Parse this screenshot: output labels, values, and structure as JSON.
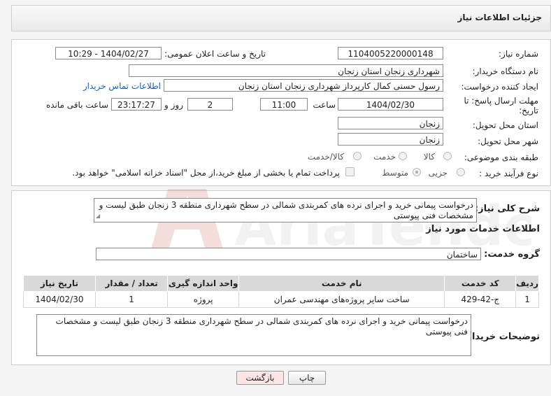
{
  "header": {
    "title": "جزئیات اطلاعات نیاز"
  },
  "form": {
    "need_number_label": "شماره نیاز:",
    "need_number": "1104005220000148",
    "announce_label": "تاریخ و ساعت اعلان عمومی:",
    "announce_value": "1404/02/27 - 10:29",
    "buyer_org_label": "نام دستگاه خریدار:",
    "buyer_org": "شهرداری زنجان استان زنجان",
    "creator_label": "ایجاد کننده درخواست:",
    "creator": "رسول حسنی کمال کارپرداز شهرداری زنجان استان زنجان",
    "contact_link": "اطلاعات تماس خریدار",
    "deadline_label_1": "مهلت ارسال پاسخ: تا",
    "deadline_label_2": "تاریخ:",
    "deadline_date": "1404/02/30",
    "time_label": "ساعت",
    "deadline_time": "11:00",
    "days_value": "2",
    "days_label": "روز و",
    "remaining_time": "23:17:27",
    "remaining_label": "ساعت باقی مانده",
    "province_label": "استان محل تحویل:",
    "province": "زنجان",
    "city_label": "شهر محل تحویل:",
    "city": "زنجان",
    "category_label": "طبقه بندی موضوعی:",
    "category_options": [
      "کالا",
      "خدمت",
      "کالا/خدمت"
    ],
    "process_label": "نوع فرآیند خرید :",
    "process_options": [
      "جزیی",
      "متوسط"
    ],
    "payment_note": "پرداخت تمام یا بخشی از مبلغ خرید،از محل \"اسناد خزانه اسلامی\" خواهد بود."
  },
  "summary": {
    "label": "شرح کلی نیاز:",
    "text": "درخواست پیمانی خرید و اجرای نرده های کمربندی شمالی در سطح شهرداری منطقه 3 زنجان طبق لیست و مشخصات فنی پیوستی"
  },
  "services": {
    "section_title": "اطلاعات خدمات مورد نیاز",
    "group_label": "گروه خدمت:",
    "group_value": "ساختمان",
    "columns": [
      "ردیف",
      "کد خدمت",
      "نام خدمت",
      "واحد اندازه گیری",
      "تعداد / مقدار",
      "تاریخ نیاز"
    ],
    "rows": [
      [
        "1",
        "ج-42-429",
        "ساخت سایر پروژه‌های مهندسی عمران",
        "پروژه",
        "1",
        "1404/02/30"
      ]
    ]
  },
  "buyer_notes": {
    "label": "توضیحات خریدار:",
    "text": "درخواست پیمانی خرید و اجرای نرده های کمربندی شمالی در سطح شهرداری منطقه 3 زنجان طبق لیست و مشخصات فنی پیوستی"
  },
  "actions": {
    "print": "چاپ",
    "back": "بازگشت"
  },
  "watermark": {
    "text": "AriaTender.neT"
  },
  "colors": {
    "link": "#1a5fb4",
    "back_button": "#fde5e5",
    "header_bg": "#ececec"
  }
}
